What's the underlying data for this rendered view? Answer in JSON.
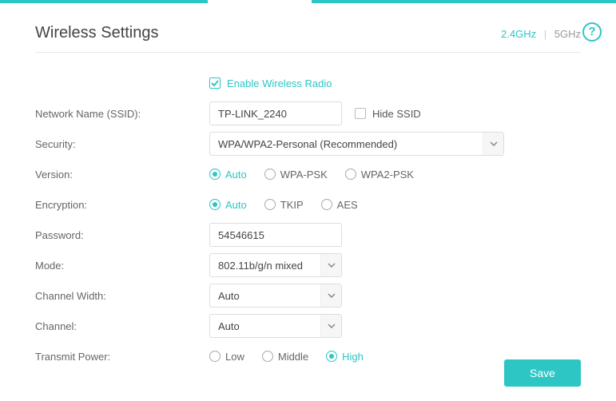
{
  "title": "Wireless Settings",
  "bands": {
    "active": "2.4GHz",
    "other": "5GHz"
  },
  "enable_radio": {
    "label": "Enable Wireless Radio",
    "checked": true
  },
  "ssid": {
    "label": "Network Name (SSID):",
    "value": "TP-LINK_2240"
  },
  "hide_ssid": {
    "label": "Hide SSID",
    "checked": false
  },
  "security": {
    "label": "Security:",
    "value": "WPA/WPA2-Personal (Recommended)"
  },
  "version": {
    "label": "Version:",
    "options": [
      "Auto",
      "WPA-PSK",
      "WPA2-PSK"
    ],
    "selected": 0
  },
  "encryption": {
    "label": "Encryption:",
    "options": [
      "Auto",
      "TKIP",
      "AES"
    ],
    "selected": 0
  },
  "password": {
    "label": "Password:",
    "value": "54546615"
  },
  "mode": {
    "label": "Mode:",
    "value": "802.11b/g/n mixed"
  },
  "channel_width": {
    "label": "Channel Width:",
    "value": "Auto"
  },
  "channel": {
    "label": "Channel:",
    "value": "Auto"
  },
  "transmit_power": {
    "label": "Transmit Power:",
    "options": [
      "Low",
      "Middle",
      "High"
    ],
    "selected": 2
  },
  "save_label": "Save"
}
